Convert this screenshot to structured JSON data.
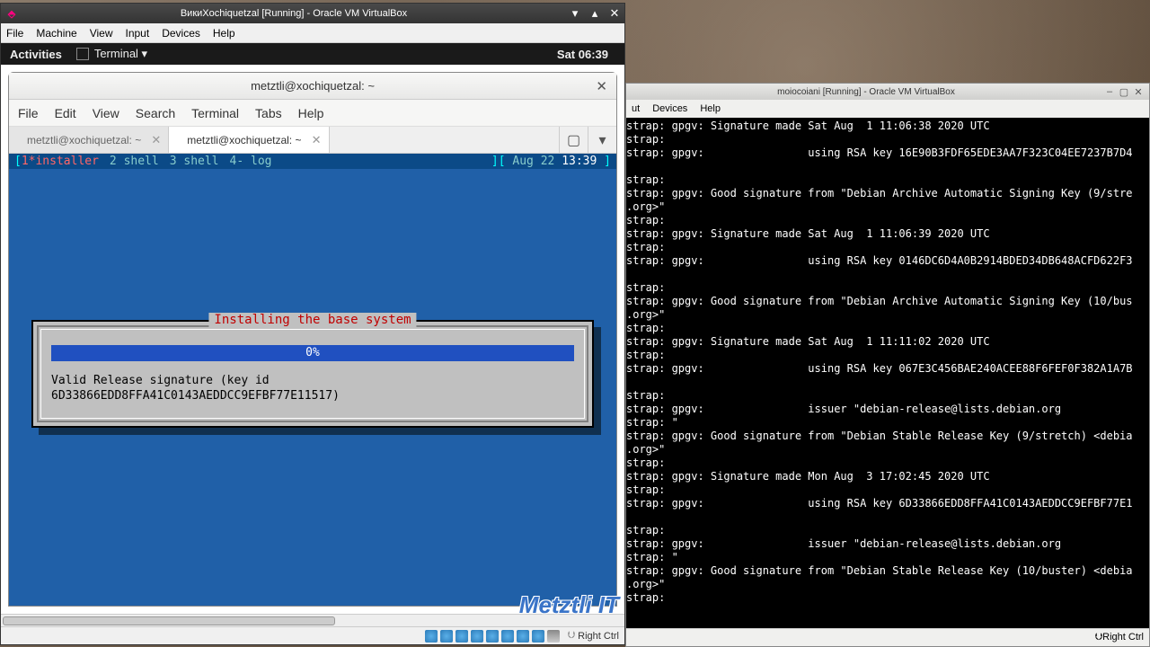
{
  "vm1": {
    "title": "ВикиXochiquetzal [Running] - Oracle VM VirtualBox",
    "menubar": [
      "File",
      "Machine",
      "View",
      "Input",
      "Devices",
      "Help"
    ],
    "gnome": {
      "activities": "Activities",
      "app": "Terminal ▾",
      "clock": "Sat 06:39"
    },
    "term": {
      "title": "metztli@xochiquetzal: ~",
      "menu": [
        "File",
        "Edit",
        "View",
        "Search",
        "Terminal",
        "Tabs",
        "Help"
      ],
      "tabs": [
        {
          "label": "metztli@xochiquetzal: ~",
          "active": false
        },
        {
          "label": "metztli@xochiquetzal: ~",
          "active": true
        }
      ],
      "screen": {
        "wins": [
          "1*installer",
          "2 shell",
          "3 shell",
          "4- log"
        ],
        "date": "Aug 22",
        "time": "13:39"
      },
      "installer": {
        "legend": "Installing the base system",
        "progress": "0%",
        "message": "Valid Release signature (key id\n6D33866EDD8FFA41C0143AEDDCC9EFBF77E11517)"
      }
    },
    "hostkey": "Right Ctrl",
    "watermark": "Metztli IT"
  },
  "vm2": {
    "title": "moiocoiani [Running] - Oracle VM VirtualBox",
    "menubar_visible": [
      "ut",
      "Devices",
      "Help"
    ],
    "hostkey": "Right Ctrl",
    "lines": [
      "strap: gpgv: Signature made Sat Aug  1 11:06:38 2020 UTC",
      "strap:",
      "strap: gpgv:                using RSA key 16E90B3FDF65EDE3AA7F323C04EE7237B7D4",
      "",
      "strap:",
      "strap: gpgv: Good signature from \"Debian Archive Automatic Signing Key (9/stre",
      ".org>\"",
      "strap:",
      "strap: gpgv: Signature made Sat Aug  1 11:06:39 2020 UTC",
      "strap:",
      "strap: gpgv:                using RSA key 0146DC6D4A0B2914BDED34DB648ACFD622F3",
      "",
      "strap:",
      "strap: gpgv: Good signature from \"Debian Archive Automatic Signing Key (10/bus",
      ".org>\"",
      "strap:",
      "strap: gpgv: Signature made Sat Aug  1 11:11:02 2020 UTC",
      "strap:",
      "strap: gpgv:                using RSA key 067E3C456BAE240ACEE88F6FEF0F382A1A7B",
      "",
      "strap:",
      "strap: gpgv:                issuer \"debian-release@lists.debian.org",
      "strap: \"",
      "strap: gpgv: Good signature from \"Debian Stable Release Key (9/stretch) <debia",
      ".org>\"",
      "strap:",
      "strap: gpgv: Signature made Mon Aug  3 17:02:45 2020 UTC",
      "strap:",
      "strap: gpgv:                using RSA key 6D33866EDD8FFA41C0143AEDDCC9EFBF77E1",
      "",
      "strap:",
      "strap: gpgv:                issuer \"debian-release@lists.debian.org",
      "strap: \"",
      "strap: gpgv: Good signature from \"Debian Stable Release Key (10/buster) <debia",
      ".org>\"",
      "strap:"
    ]
  }
}
